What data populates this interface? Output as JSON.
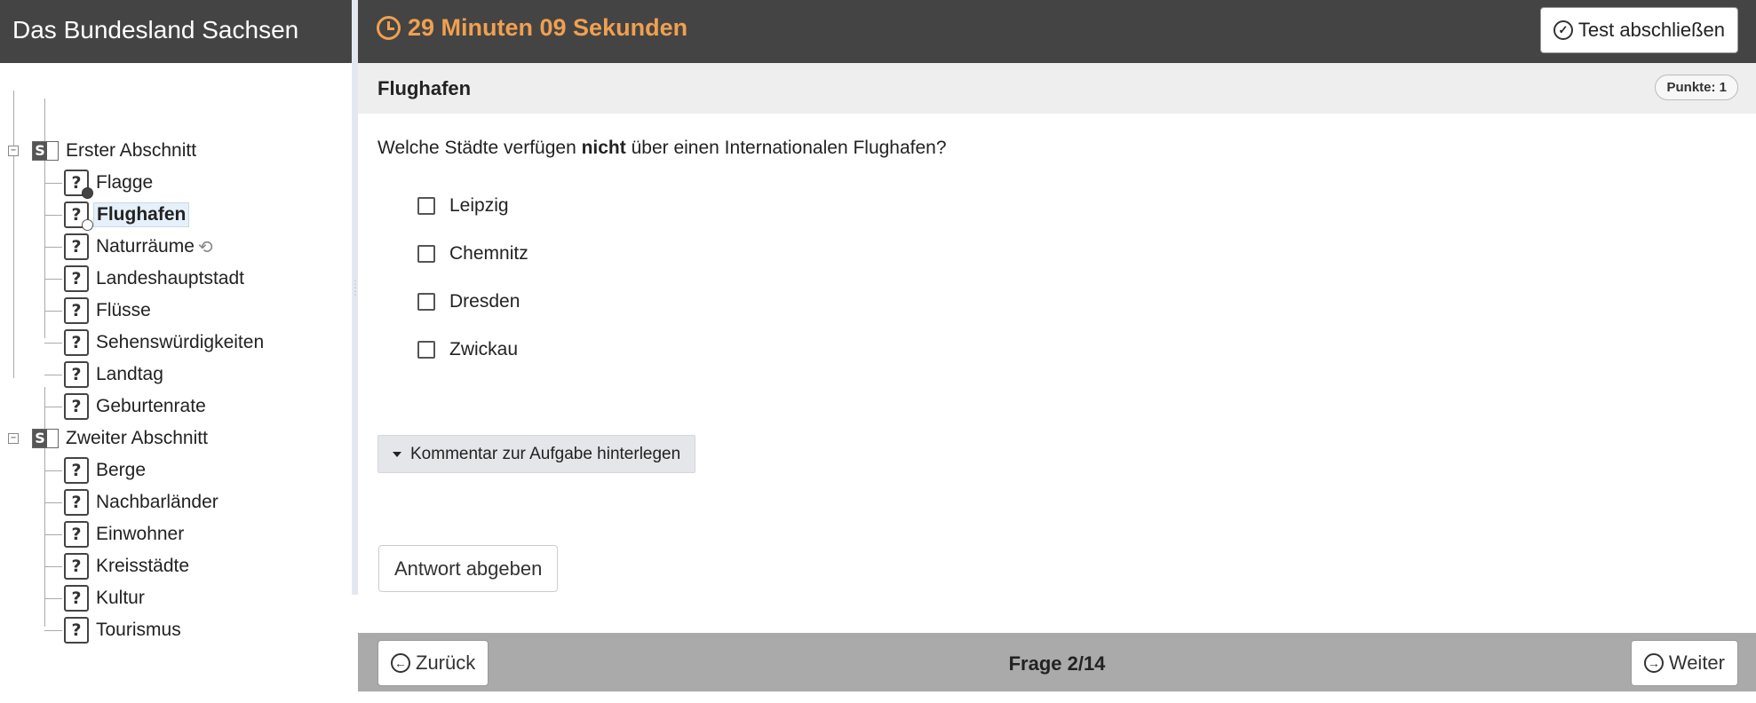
{
  "sidebar": {
    "title": "Das Bundesland Sachsen",
    "sections": [
      {
        "label": "Erster Abschnitt",
        "items": [
          {
            "label": "Flagge",
            "status": "answered"
          },
          {
            "label": "Flughafen",
            "status": "current",
            "active": true
          },
          {
            "label": "Naturräume",
            "status": "reset"
          },
          {
            "label": "Landeshauptstadt"
          },
          {
            "label": "Flüsse"
          },
          {
            "label": "Sehenswürdigkeiten"
          },
          {
            "label": "Landtag"
          },
          {
            "label": "Geburtenrate"
          }
        ]
      },
      {
        "label": "Zweiter Abschnitt",
        "items": [
          {
            "label": "Berge"
          },
          {
            "label": "Nachbarländer"
          },
          {
            "label": "Einwohner"
          },
          {
            "label": "Kreisstädte"
          },
          {
            "label": "Kultur"
          },
          {
            "label": "Tourismus"
          }
        ]
      }
    ],
    "section_icon_letter": "S",
    "question_icon_glyph": "?",
    "expander_glyph": "−"
  },
  "topbar": {
    "timer": "29 Minuten 09 Sekunden",
    "timer_color": "#f0a050",
    "finish_label": "Test abschließen"
  },
  "question": {
    "title": "Flughafen",
    "points": "Punkte: 1",
    "text_before": "Welche Städte verfügen ",
    "text_bold": "nicht",
    "text_after": " über einen Internationalen Flughafen?",
    "options": [
      "Leipzig",
      "Chemnitz",
      "Dresden",
      "Zwickau"
    ],
    "comment_label": "Kommentar zur Aufgabe hinterlegen",
    "submit_label": "Antwort abgeben"
  },
  "navigation": {
    "prev_label": "Zurück",
    "next_label": "Weiter",
    "page_indicator": "Frage 2/14"
  }
}
